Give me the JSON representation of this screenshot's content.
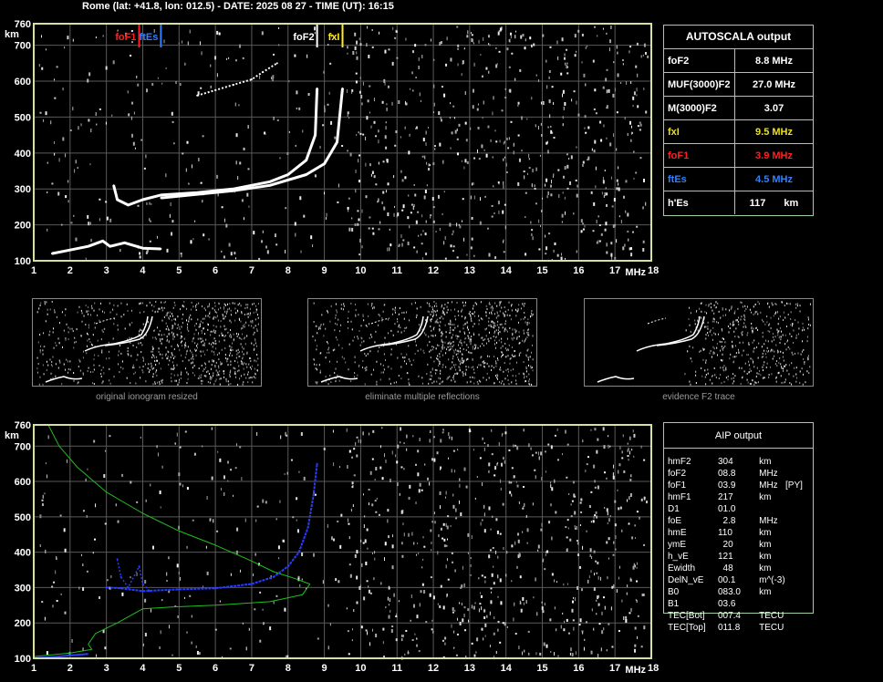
{
  "header": "Rome (lat: +41.8, lon: 012.5) - DATE: 2025 08 27 - TIME (UT): 16:15",
  "colors": {
    "grid": "#5a5a5a",
    "frame": "#d8e0a0",
    "trace": "#ffffff",
    "green": "#1fbf1f",
    "blue": "#2a3cff",
    "foF1": "#ff2020",
    "ftEs": "#3080ff",
    "fxI": "#ffee20",
    "foF2": "#ffffff"
  },
  "top_chart": {
    "chart_data": {
      "type": "scatter",
      "xlabel": "MHz",
      "ylabel": "km",
      "xlim": [
        1,
        18
      ],
      "ylim": [
        100,
        760
      ],
      "xticks": [
        1,
        2,
        3,
        4,
        5,
        6,
        7,
        8,
        9,
        10,
        11,
        12,
        13,
        14,
        15,
        16,
        17,
        18
      ],
      "yticks": [
        100,
        200,
        300,
        400,
        500,
        600,
        700,
        760
      ],
      "markers": [
        {
          "label": "foF1",
          "x": 3.9,
          "color": "#ff2020"
        },
        {
          "label": "ftEs",
          "x": 4.5,
          "color": "#3080ff"
        },
        {
          "label": "foF2",
          "x": 8.8,
          "color": "#ffffff"
        },
        {
          "label": "fxI",
          "x": 9.5,
          "color": "#ffee20"
        }
      ],
      "series": [
        {
          "values": [
            [
              3.2,
              310
            ],
            [
              3.3,
              270
            ],
            [
              3.6,
              255
            ],
            [
              4.0,
              270
            ],
            [
              4.5,
              283
            ],
            [
              5.5,
              290
            ],
            [
              6.5,
              300
            ],
            [
              7.5,
              320
            ],
            [
              8.0,
              340
            ],
            [
              8.5,
              380
            ],
            [
              8.75,
              450
            ],
            [
              8.8,
              580
            ]
          ]
        },
        {
          "values": [
            [
              4.5,
              275
            ],
            [
              5.5,
              285
            ],
            [
              6.5,
              295
            ],
            [
              7.5,
              310
            ],
            [
              8.5,
              340
            ],
            [
              9.0,
              370
            ],
            [
              9.35,
              430
            ],
            [
              9.5,
              580
            ]
          ]
        },
        {
          "values": [
            [
              1.5,
              120
            ],
            [
              2.0,
              130
            ],
            [
              2.5,
              140
            ],
            [
              2.9,
              155
            ],
            [
              3.1,
              140
            ],
            [
              3.5,
              150
            ],
            [
              4.0,
              135
            ],
            [
              4.5,
              133
            ]
          ]
        },
        {
          "values": [
            [
              5.5,
              560
            ],
            [
              6.0,
              575
            ],
            [
              6.5,
              590
            ],
            [
              7.0,
              605
            ],
            [
              7.3,
              625
            ],
            [
              7.7,
              650
            ]
          ]
        }
      ]
    }
  },
  "bottom_chart": {
    "chart_data": {
      "type": "line",
      "xlabel": "MHz",
      "ylabel": "km",
      "xlim": [
        1,
        18
      ],
      "ylim": [
        100,
        760
      ],
      "xticks": [
        1,
        2,
        3,
        4,
        5,
        6,
        7,
        8,
        9,
        10,
        11,
        12,
        13,
        14,
        15,
        16,
        17,
        18
      ],
      "yticks": [
        100,
        200,
        300,
        400,
        500,
        600,
        700,
        760
      ],
      "series": [
        {
          "values": [
            [
              1.4,
              760
            ],
            [
              1.7,
              700
            ],
            [
              2.2,
              640
            ],
            [
              3.0,
              570
            ],
            [
              4.0,
              510
            ],
            [
              5.0,
              460
            ],
            [
              6.0,
              420
            ],
            [
              7.0,
              375
            ],
            [
              7.6,
              345
            ],
            [
              8.2,
              325
            ],
            [
              8.6,
              310
            ]
          ]
        },
        {
          "values": [
            [
              8.6,
              310
            ],
            [
              8.4,
              280
            ],
            [
              7.5,
              260
            ],
            [
              6.0,
              250
            ],
            [
              4.8,
              245
            ],
            [
              4.0,
              240
            ],
            [
              3.3,
              200
            ],
            [
              2.7,
              170
            ],
            [
              2.5,
              140
            ],
            [
              2.6,
              125
            ],
            [
              2.0,
              115
            ],
            [
              1.0,
              105
            ]
          ]
        },
        {
          "values": [
            [
              3.0,
              300
            ],
            [
              3.4,
              298
            ],
            [
              4.0,
              290
            ],
            [
              5.0,
              295
            ],
            [
              6.0,
              298
            ],
            [
              7.0,
              310
            ],
            [
              7.6,
              330
            ],
            [
              8.0,
              360
            ],
            [
              8.3,
              400
            ],
            [
              8.55,
              470
            ],
            [
              8.7,
              560
            ],
            [
              8.8,
              650
            ]
          ]
        },
        {
          "values": [
            [
              3.3,
              380
            ],
            [
              3.4,
              330
            ],
            [
              3.6,
              300
            ],
            [
              3.9,
              360
            ],
            [
              4.0,
              310
            ],
            [
              4.2,
              290
            ]
          ]
        },
        {
          "values": [
            [
              1.0,
              100
            ],
            [
              1.5,
              103
            ],
            [
              2.0,
              108
            ],
            [
              2.5,
              112
            ]
          ]
        }
      ]
    }
  },
  "autoscala": {
    "title": "AUTOSCALA output",
    "rows": [
      {
        "label": "foF2",
        "value": "8.8 MHz",
        "color": "#ffffff"
      },
      {
        "label": "MUF(3000)F2",
        "value": "27.0 MHz",
        "color": "#ffffff"
      },
      {
        "label": "M(3000)F2",
        "value": "3.07",
        "color": "#ffffff"
      },
      {
        "label": "fxI",
        "value": "9.5 MHz",
        "color": "#e8e020"
      },
      {
        "label": "foF1",
        "value": "3.9 MHz",
        "color": "#ff2020"
      },
      {
        "label": "ftEs",
        "value": "4.5 MHz",
        "color": "#3080ff"
      },
      {
        "label": "h'Es",
        "value": "117",
        "unit": "km",
        "color": "#ffffff"
      }
    ]
  },
  "thumbnails": [
    {
      "caption": "original ionogram resized"
    },
    {
      "caption": "eliminate multiple reflections"
    },
    {
      "caption": "evidence F2 trace"
    }
  ],
  "aip": {
    "title": "AIP output",
    "rows": [
      {
        "k": "hmF2",
        "v": "304",
        "u": "km"
      },
      {
        "k": "foF2",
        "v": "08.8",
        "u": "MHz"
      },
      {
        "k": "foF1",
        "v": "03.9",
        "u": "MHz   [PY]"
      },
      {
        "k": "hmF1",
        "v": "217",
        "u": "km"
      },
      {
        "k": "D1",
        "v": "01.0",
        "u": ""
      },
      {
        "k": "foE",
        "v": "  2.8",
        "u": "MHz"
      },
      {
        "k": "hmE",
        "v": "110",
        "u": "km"
      },
      {
        "k": "ymE",
        "v": "  20",
        "u": "km"
      },
      {
        "k": "h_vE",
        "v": "121",
        "u": "km"
      },
      {
        "k": "Ewidth",
        "v": "  48",
        "u": "km"
      },
      {
        "k": "DelN_vE",
        "v": "00.1",
        "u": "m^(-3)"
      },
      {
        "k": "B0",
        "v": "083.0",
        "u": "km"
      },
      {
        "k": "B1",
        "v": "03.6",
        "u": ""
      },
      {
        "k": "TEC[Bot]",
        "v": "007.4",
        "u": "TECU"
      },
      {
        "k": "TEC[Top]",
        "v": "011.8",
        "u": "TECU"
      }
    ]
  }
}
